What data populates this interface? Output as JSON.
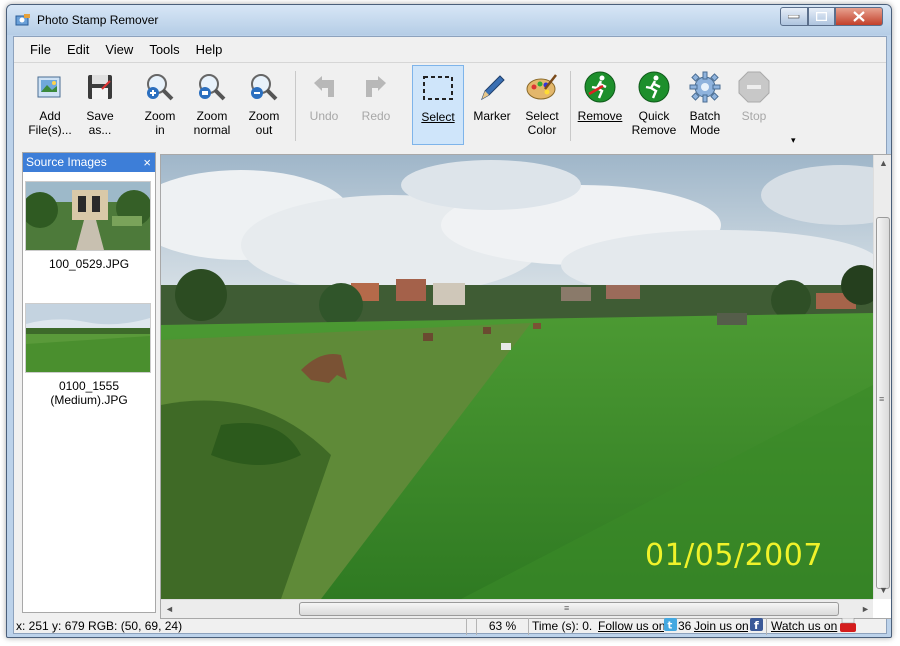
{
  "window": {
    "title": "Photo Stamp Remover",
    "controls": [
      "minimize",
      "maximize",
      "close"
    ]
  },
  "menu": [
    {
      "label": "File",
      "icon": null
    },
    {
      "label": "Edit"
    },
    {
      "label": "View"
    },
    {
      "label": "Tools"
    },
    {
      "label": "Help"
    }
  ],
  "toolbar": {
    "add_files": {
      "line1": "Add",
      "line2": "File(s)..."
    },
    "save_as": {
      "line1": "Save",
      "line2": "as..."
    },
    "zoom_in": {
      "line1": "Zoom",
      "line2": "in"
    },
    "zoom_normal": {
      "line1": "Zoom",
      "line2": "normal"
    },
    "zoom_out": {
      "line1": "Zoom",
      "line2": "out"
    },
    "undo": {
      "line1": "Undo"
    },
    "redo": {
      "line1": "Redo"
    },
    "select": {
      "line1": "Select"
    },
    "marker": {
      "line1": "Marker"
    },
    "select_color": {
      "line1": "Select",
      "line2": "Color"
    },
    "remove": {
      "line1": "Remove"
    },
    "quick_remove": {
      "line1": "Quick",
      "line2": "Remove"
    },
    "batch_mode": {
      "line1": "Batch",
      "line2": "Mode"
    },
    "stop": {
      "line1": "Stop"
    },
    "more": "▾"
  },
  "sidebar": {
    "title": "Source Images",
    "close": "×",
    "items": [
      {
        "label": "100_0529.JPG"
      },
      {
        "label_line1": "0100_1555",
        "label_line2": "(Medium).JPG"
      }
    ]
  },
  "viewer": {
    "date_stamp": "01/05/2007",
    "scroll_up": "▲",
    "scroll_down": "▼",
    "scroll_left": "◄",
    "scroll_right": "►",
    "grip": "≡"
  },
  "status": {
    "coords": "x: 251 y: 679  RGB: (50, 69, 24)",
    "zoom": "63 %",
    "time": "Time (s): 0.",
    "follow": "Follow us on",
    "count": "36",
    "join": "Join us on",
    "watch": "Watch us on"
  },
  "colors": {
    "accent": "#3d7ed8",
    "selected_bg": "#cfe5fa",
    "date_stamp": "#f0f22a"
  }
}
